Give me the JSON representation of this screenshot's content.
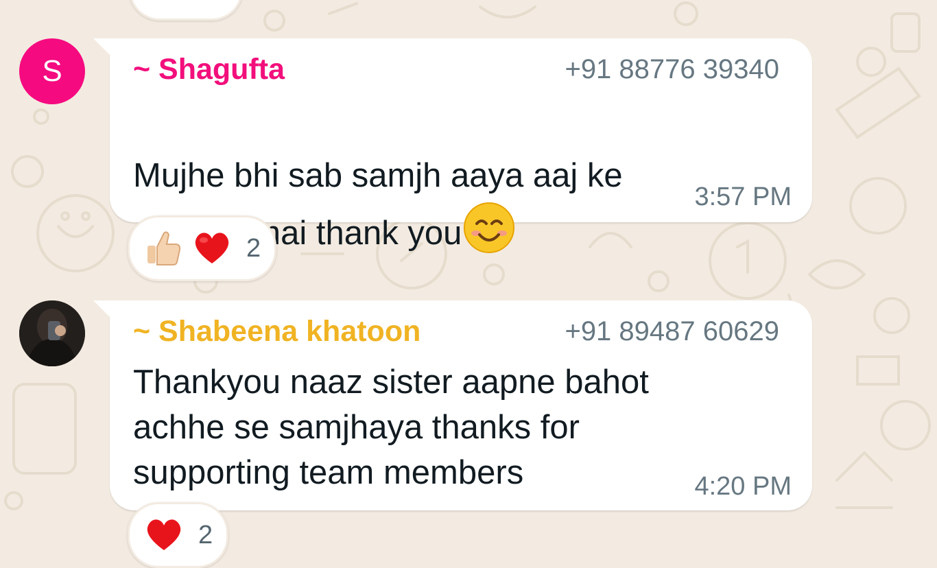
{
  "theme": {
    "wallpaper": "#f3ebe1",
    "shagufta_name_color": "#f20f7c",
    "shabeena_name_color": "#f0b323",
    "avatar_shagufta_bg": "#f50a80",
    "meta_text": "#667781"
  },
  "messages": [
    {
      "avatar_initial": "S",
      "sender_name": "~ Shagufta",
      "sender_phone": "+91 88776 39340",
      "text": "Mujhe bhi sab samjh aaya aaj ke\nmetting mai thank you",
      "emoji_icon": "smiling-face-icon",
      "time": "3:57 PM",
      "reactions": {
        "icons": [
          "thumbs-up-icon",
          "red-heart-icon"
        ],
        "count": "2"
      }
    },
    {
      "avatar_icon": "profile-photo-avatar",
      "sender_name": "~ Shabeena khatoon",
      "sender_phone": "+91 89487 60629",
      "text": "Thankyou naaz sister aapne bahot\nachhe se samjhaya thanks for\nsupporting team members",
      "time": "4:20 PM",
      "reactions": {
        "icons": [
          "red-heart-icon"
        ],
        "count": "2"
      }
    }
  ]
}
